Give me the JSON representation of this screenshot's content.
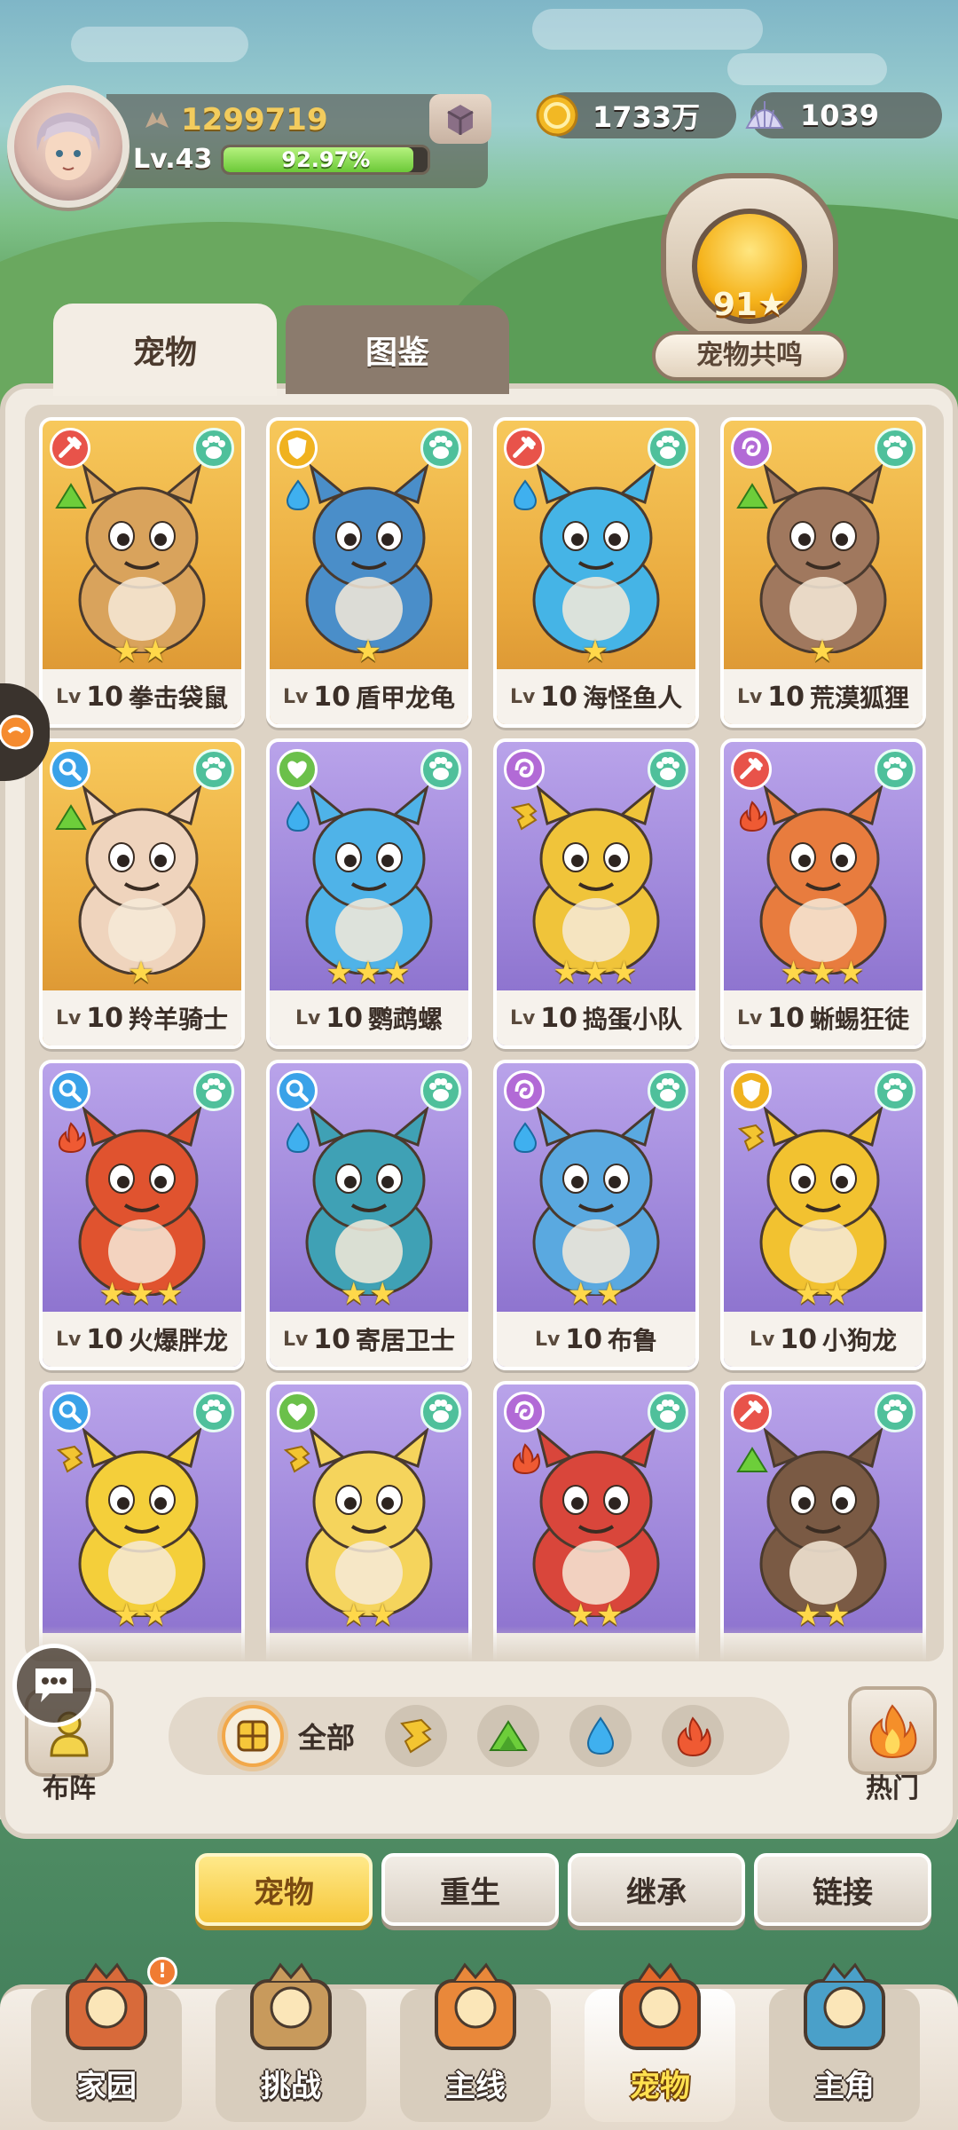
{
  "player": {
    "power": "1299719",
    "level": "Lv.43",
    "exp_percent": "92.97%",
    "exp_fraction": 0.9297
  },
  "currencies": [
    {
      "icon": "gold-coin-icon",
      "value": "1733万"
    },
    {
      "icon": "shell-icon",
      "value": "1039"
    }
  ],
  "resonance": {
    "count": "91★",
    "label": "宠物共鸣"
  },
  "tabs": [
    {
      "label": "宠物",
      "active": true
    },
    {
      "label": "图鉴",
      "active": false
    }
  ],
  "pets": [
    {
      "lv_prefix": "Lv",
      "level": "10",
      "name": "拳击袋鼠",
      "stars": "★★",
      "bg": "gold",
      "role": "attack",
      "element": "grass",
      "color": "#d9a35c"
    },
    {
      "lv_prefix": "Lv",
      "level": "10",
      "name": "盾甲龙龟",
      "stars": "★",
      "bg": "gold",
      "role": "defense",
      "element": "water",
      "color": "#4a8ec9"
    },
    {
      "lv_prefix": "Lv",
      "level": "10",
      "name": "海怪鱼人",
      "stars": "★",
      "bg": "gold",
      "role": "attack",
      "element": "water",
      "color": "#45b4e6"
    },
    {
      "lv_prefix": "Lv",
      "level": "10",
      "name": "荒漠狐狸",
      "stars": "★",
      "bg": "gold",
      "role": "magic",
      "element": "grass",
      "color": "#a0785e"
    },
    {
      "lv_prefix": "Lv",
      "level": "10",
      "name": "羚羊骑士",
      "stars": "★",
      "bg": "gold",
      "role": "agile",
      "element": "grass",
      "color": "#efd4bd"
    },
    {
      "lv_prefix": "Lv",
      "level": "10",
      "name": "鹦鹉螺",
      "stars": "★★★",
      "bg": "purple",
      "role": "support",
      "element": "water",
      "color": "#4fb3e8"
    },
    {
      "lv_prefix": "Lv",
      "level": "10",
      "name": "捣蛋小队",
      "stars": "★★★",
      "bg": "purple",
      "role": "magic",
      "element": "earth",
      "color": "#f0c43a"
    },
    {
      "lv_prefix": "Lv",
      "level": "10",
      "name": "蜥蜴狂徒",
      "stars": "★★★",
      "bg": "purple",
      "role": "attack",
      "element": "fire",
      "color": "#e87c3e"
    },
    {
      "lv_prefix": "Lv",
      "level": "10",
      "name": "火爆胖龙",
      "stars": "★★★",
      "bg": "purple",
      "role": "agile",
      "element": "fire",
      "color": "#e0532f"
    },
    {
      "lv_prefix": "Lv",
      "level": "10",
      "name": "寄居卫士",
      "stars": "★★",
      "bg": "purple",
      "role": "agile",
      "element": "water",
      "color": "#3fa1b5"
    },
    {
      "lv_prefix": "Lv",
      "level": "10",
      "name": "布鲁",
      "stars": "★★",
      "bg": "purple",
      "role": "magic",
      "element": "water",
      "color": "#5aa9e0"
    },
    {
      "lv_prefix": "Lv",
      "level": "10",
      "name": "小狗龙",
      "stars": "★★",
      "bg": "purple",
      "role": "defense",
      "element": "earth",
      "color": "#f2c230"
    },
    {
      "lv_prefix": "",
      "level": "",
      "name": "",
      "stars": "★★",
      "bg": "purple",
      "role": "agile",
      "element": "earth",
      "color": "#f4cf3a"
    },
    {
      "lv_prefix": "",
      "level": "",
      "name": "",
      "stars": "★★",
      "bg": "purple",
      "role": "support",
      "element": "earth",
      "color": "#f5d45c"
    },
    {
      "lv_prefix": "",
      "level": "",
      "name": "",
      "stars": "★★",
      "bg": "purple",
      "role": "magic",
      "element": "fire",
      "color": "#d9463b"
    },
    {
      "lv_prefix": "",
      "level": "",
      "name": "",
      "stars": "★★",
      "bg": "purple",
      "role": "attack",
      "element": "grass",
      "color": "#7a5a44"
    }
  ],
  "filters": {
    "left_button": "布阵",
    "right_button": "热门",
    "all_label": "全部",
    "elements": [
      "earth",
      "grass",
      "water",
      "fire"
    ]
  },
  "actions": [
    {
      "label": "宠物",
      "primary": true
    },
    {
      "label": "重生",
      "primary": false
    },
    {
      "label": "继承",
      "primary": false
    },
    {
      "label": "链接",
      "primary": false
    }
  ],
  "nav": [
    {
      "label": "家园",
      "icon": "home-icon",
      "badge": "!",
      "active": false
    },
    {
      "label": "挑战",
      "icon": "challenge-icon",
      "badge": "",
      "active": false
    },
    {
      "label": "主线",
      "icon": "main-quest-icon",
      "badge": "",
      "active": false
    },
    {
      "label": "宠物",
      "icon": "pet-icon",
      "badge": "",
      "active": true
    },
    {
      "label": "主角",
      "icon": "hero-icon",
      "badge": "",
      "active": false
    }
  ],
  "colors": {
    "gold_card": "#f0b94a",
    "purple_card": "#a58ee0",
    "accent_yellow": "#f6c73a",
    "badge_green": "#4fc09b"
  }
}
